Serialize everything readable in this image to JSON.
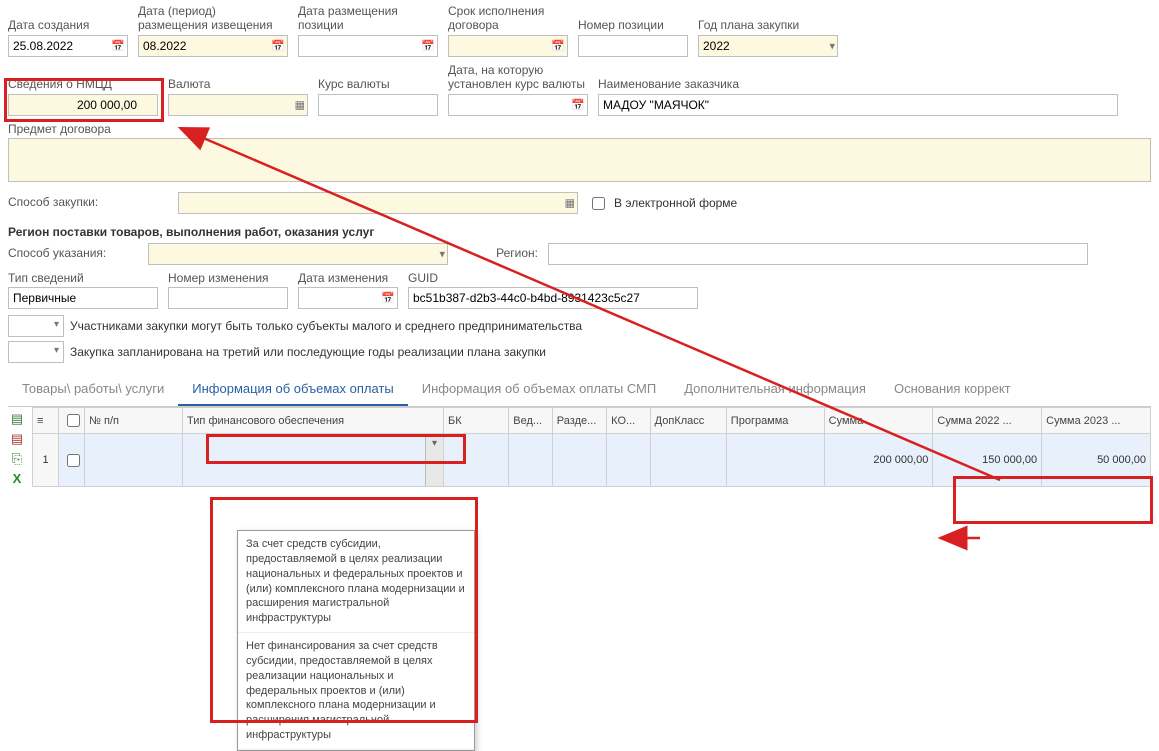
{
  "row1": {
    "created_label": "Дата создания",
    "created_value": "25.08.2022",
    "notice_period_label": "Дата (период)\nразмещения извещения",
    "notice_period_value": "08.2022",
    "pos_date_label": "Дата размещения\nпозиции",
    "pos_date_value": "",
    "deadline_label": "Срок исполнения\nдоговора",
    "deadline_value": "",
    "pos_num_label": "Номер позиции",
    "pos_num_value": "",
    "plan_year_label": "Год плана закупки",
    "plan_year_value": "2022"
  },
  "row2": {
    "nmcd_label": "Сведения о НМЦД",
    "nmcd_value": "200 000,00",
    "currency_label": "Валюта",
    "currency_value": "",
    "rate_label": "Курс валюты",
    "rate_value": "",
    "rate_date_label": "Дата, на которую\nустановлен курс валюты",
    "rate_date_value": "",
    "customer_label": "Наименование заказчика",
    "customer_value": "МАДОУ \"МАЯЧОК\""
  },
  "subject_label": "Предмет договора",
  "subject_value": "",
  "purchase_method_label": "Способ закупки:",
  "purchase_method_value": "",
  "electronic_label": "В электронной форме",
  "region_section": "Регион поставки товаров, выполнения работ, оказания услуг",
  "spec_method_label": "Способ указания:",
  "spec_method_value": "",
  "region_label": "Регион:",
  "region_value": "",
  "row4": {
    "info_type_label": "Тип сведений",
    "info_type_value": "Первичные",
    "change_num_label": "Номер изменения",
    "change_num_value": "",
    "change_date_label": "Дата изменения",
    "change_date_value": "",
    "guid_label": "GUID",
    "guid_value": "bc51b387-d2b3-44c0-b4bd-8931423c5c27"
  },
  "check1_label": "Участниками закупки могут быть только субъекты малого и среднего предпринимательства",
  "check2_label": "Закупка запланирована на третий или последующие годы реализации плана закупки",
  "tabs": {
    "t1": "Товары\\ работы\\ услуги",
    "t2": "Информация об объемах оплаты",
    "t3": "Информация об объемах оплаты СМП",
    "t4": "Дополнительная информация",
    "t5": "Основания коррект"
  },
  "grid_headers": {
    "h_menu": "≡",
    "h_num": "№ п/п",
    "h_type": "Тип финансового обеспечения",
    "h_bk": "БК",
    "h_ved": "Вед...",
    "h_razd": "Разде...",
    "h_ko": "КО...",
    "h_dopklass": "ДопКласс",
    "h_prog": "Программа",
    "h_sum": "Сумма",
    "h_sum2022": "Сумма 2022 ...",
    "h_sum2023": "Сумма 2023 ..."
  },
  "grid_row": {
    "num": "1",
    "bk": "...",
    "sum": "200 000,00",
    "sum2022": "150 000,00",
    "sum2023": "50 000,00"
  },
  "dropdown_options": {
    "opt1": "За счет средств субсидии, предоставляемой в целях реализации национальных и федеральных проектов и (или) комплексного плана модернизации и расширения магистральной инфраструктуры",
    "opt2": "Нет финансирования за счет средств субсидии, предоставляемой в целях реализации национальных и федеральных проектов и (или) комплексного плана модернизации и расширения магистральной инфраструктуры"
  }
}
